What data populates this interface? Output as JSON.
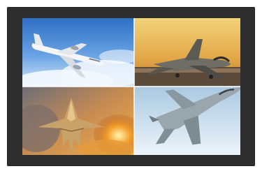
{
  "display": {
    "frame_color": "#2e2e2e",
    "tiles": [
      {
        "id": "tile-airliner",
        "subject": "airliner-in-blue-sky",
        "sky": "#4a86d6"
      },
      {
        "id": "tile-tarmac",
        "subject": "fighter-jet-on-runway-at-sunset",
        "sky": "#e8b04a"
      },
      {
        "id": "tile-stealth",
        "subject": "stealth-fighter-with-fire-and-smoke",
        "sky": "#d98a3a"
      },
      {
        "id": "tile-eagle",
        "subject": "fighter-jet-in-pale-sky",
        "sky": "#b9d6ea"
      }
    ]
  }
}
